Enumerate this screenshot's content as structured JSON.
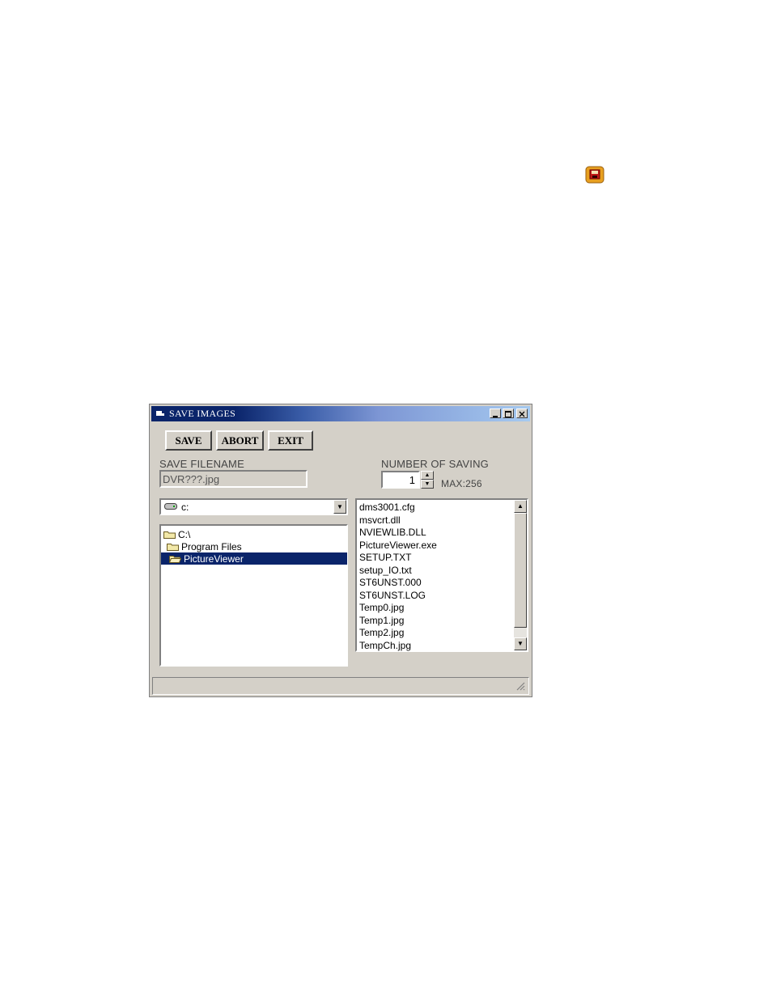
{
  "colors": {
    "selection": "#0a246a",
    "face": "#d4d0c8"
  },
  "save_icon": {
    "icon": "save-images-icon"
  },
  "window": {
    "title": "SAVE IMAGES",
    "buttons": {
      "save": "SAVE",
      "abort": "ABORT",
      "exit": "EXIT"
    },
    "filename": {
      "label": "SAVE FILENAME",
      "value": "DVR???.jpg"
    },
    "count": {
      "label": "NUMBER OF SAVING",
      "value": "1",
      "max": "MAX:256"
    },
    "drive": {
      "value": "c:",
      "icon": "drive-icon"
    },
    "folders": [
      {
        "name": "C:\\",
        "indent": 0,
        "selected": false
      },
      {
        "name": "Program Files",
        "indent": 1,
        "selected": false
      },
      {
        "name": "PictureViewer",
        "indent": 2,
        "selected": true
      }
    ],
    "files": [
      "dms3001.cfg",
      "msvcrt.dll",
      "NVIEWLIB.DLL",
      "PictureViewer.exe",
      "SETUP.TXT",
      "setup_IO.txt",
      "ST6UNST.000",
      "ST6UNST.LOG",
      "Temp0.jpg",
      "Temp1.jpg",
      "Temp2.jpg",
      "TempCh.jpg"
    ]
  }
}
